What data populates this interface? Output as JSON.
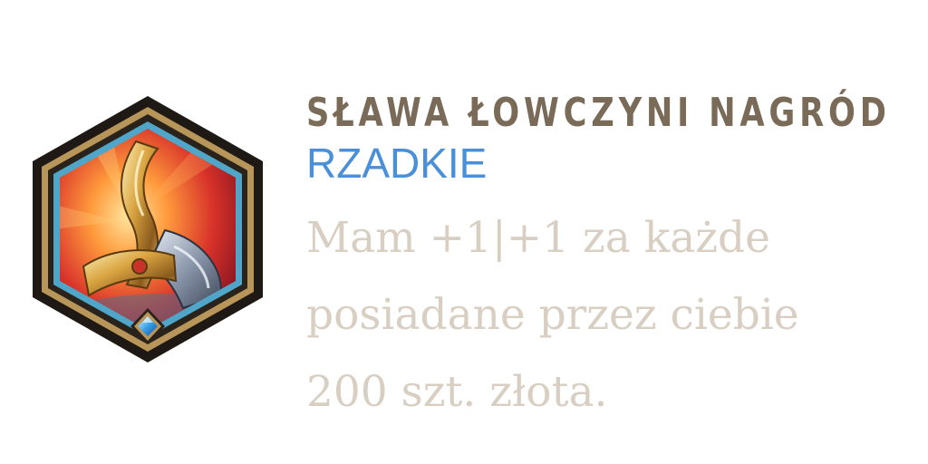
{
  "augment": {
    "name": "SŁAWA ŁOWCZYNI NAGRÓD",
    "rarity": "RZADKIE",
    "description_lines": [
      "Mam +1|+1 za każde",
      "posiadane przez ciebie",
      "200 szt. złota."
    ]
  },
  "icon": {
    "name": "bounty-hunter-sword-icon",
    "gem": "blue-diamond-gem-icon"
  },
  "colors": {
    "title": "#7a6a58",
    "rarity": "#4a90d9",
    "description": "#d8cfc2",
    "frame_gold": "#b8965a",
    "frame_dark": "#201a14",
    "frame_blue": "#4fa6c8"
  }
}
